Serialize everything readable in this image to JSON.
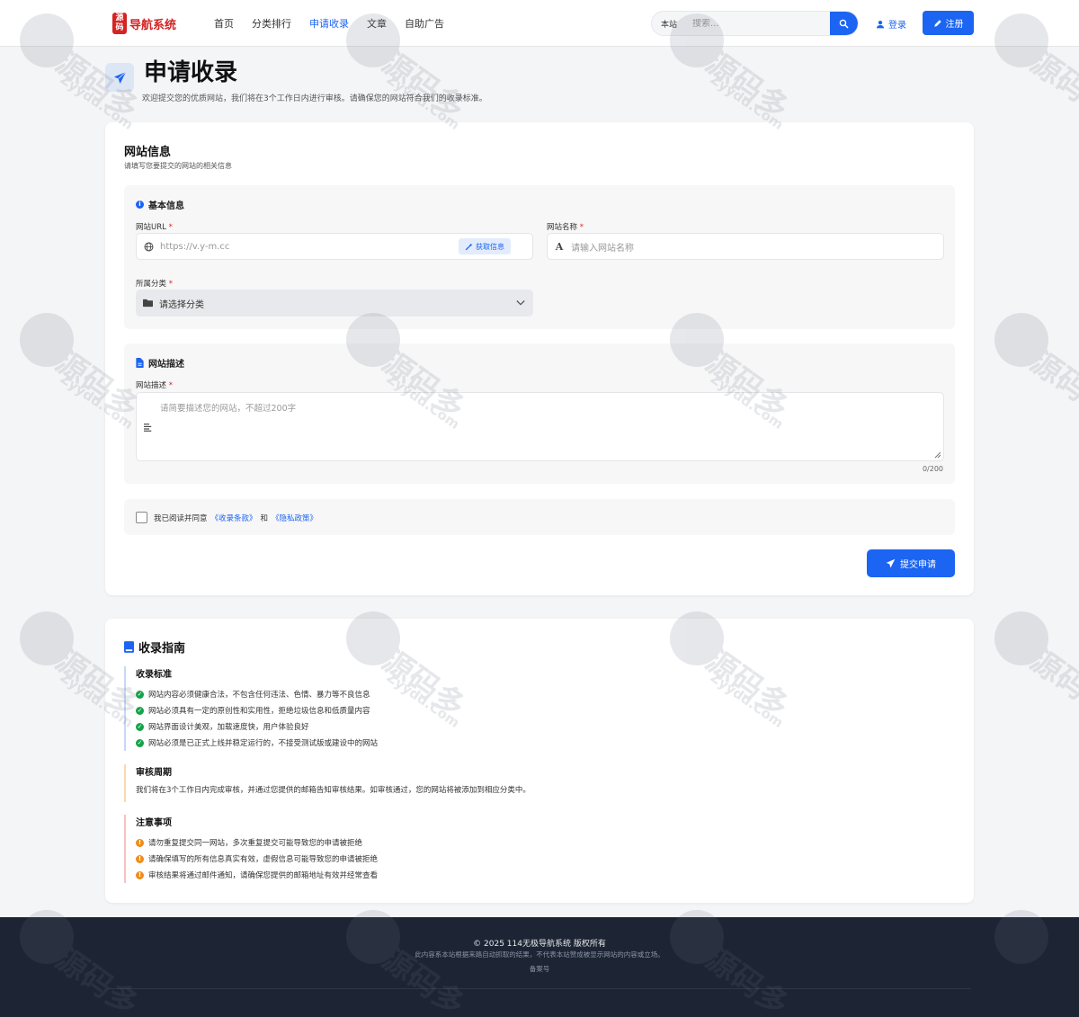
{
  "header": {
    "logo_mark": "源码",
    "logo_text": "导航系统",
    "nav": [
      {
        "label": "首页",
        "active": false
      },
      {
        "label": "分类排行",
        "active": false
      },
      {
        "label": "申请收录",
        "active": true
      },
      {
        "label": "文章",
        "active": false
      },
      {
        "label": "自助广告",
        "active": false
      }
    ],
    "search": {
      "scope": "本站",
      "placeholder": "搜索..."
    },
    "login_label": "登录",
    "register_label": "注册"
  },
  "page": {
    "title": "申请收录",
    "subtitle": "欢迎提交您的优质网站，我们将在3个工作日内进行审核。请确保您的网站符合我们的收录标准。"
  },
  "form": {
    "title": "网站信息",
    "subtitle": "请填写您要提交的网站的相关信息",
    "basic": {
      "heading": "基本信息",
      "url_label": "网站URL",
      "url_placeholder": "https://v.y-m.cc",
      "fetch_label": "获取信息",
      "name_label": "网站名称",
      "name_placeholder": "请输入网站名称",
      "category_label": "所属分类",
      "category_value": "请选择分类",
      "required_mark": "*"
    },
    "desc": {
      "heading": "网站描述",
      "label": "网站描述",
      "placeholder": "请简要描述您的网站，不超过200字",
      "counter": "0/200"
    },
    "agree": {
      "prefix": "我已阅读并同意",
      "terms": "《收录条款》",
      "and": "和",
      "privacy": "《隐私政策》"
    },
    "submit_label": "提交申请"
  },
  "guide": {
    "title": "收录指南",
    "standards": {
      "heading": "收录标准",
      "items": [
        "网站内容必须健康合法，不包含任何违法、色情、暴力等不良信息",
        "网站必须具有一定的原创性和实用性，拒绝垃圾信息和低质量内容",
        "网站界面设计美观，加载速度快，用户体验良好",
        "网站必须是已正式上线并稳定运行的，不接受测试版或建设中的网站"
      ]
    },
    "cycle": {
      "heading": "审核周期",
      "text": "我们将在3个工作日内完成审核，并通过您提供的邮箱告知审核结果。如审核通过，您的网站将被添加到相应分类中。"
    },
    "notes": {
      "heading": "注意事项",
      "items": [
        "请勿重复提交同一网站，多次重复提交可能导致您的申请被拒绝",
        "请确保填写的所有信息真实有效，虚假信息可能导致您的申请被拒绝",
        "审核结果将通过邮件通知，请确保您提供的邮箱地址有效并经常查看"
      ]
    }
  },
  "footer": {
    "copyright": "© 2025 114无极导航系统 版权所有",
    "disclaimer": "此内容系本站根据来路自动抓取的结果，不代表本站赞成被显示网站的内容或立场。",
    "icp": "备案号"
  },
  "watermark": {
    "text": "源码多",
    "url": "Zyydd.Com"
  },
  "colors": {
    "accent": "#1c64f2",
    "brand": "#d42323",
    "success": "#16a34a",
    "warning": "#f08c19",
    "footer_bg": "#1d2534"
  }
}
